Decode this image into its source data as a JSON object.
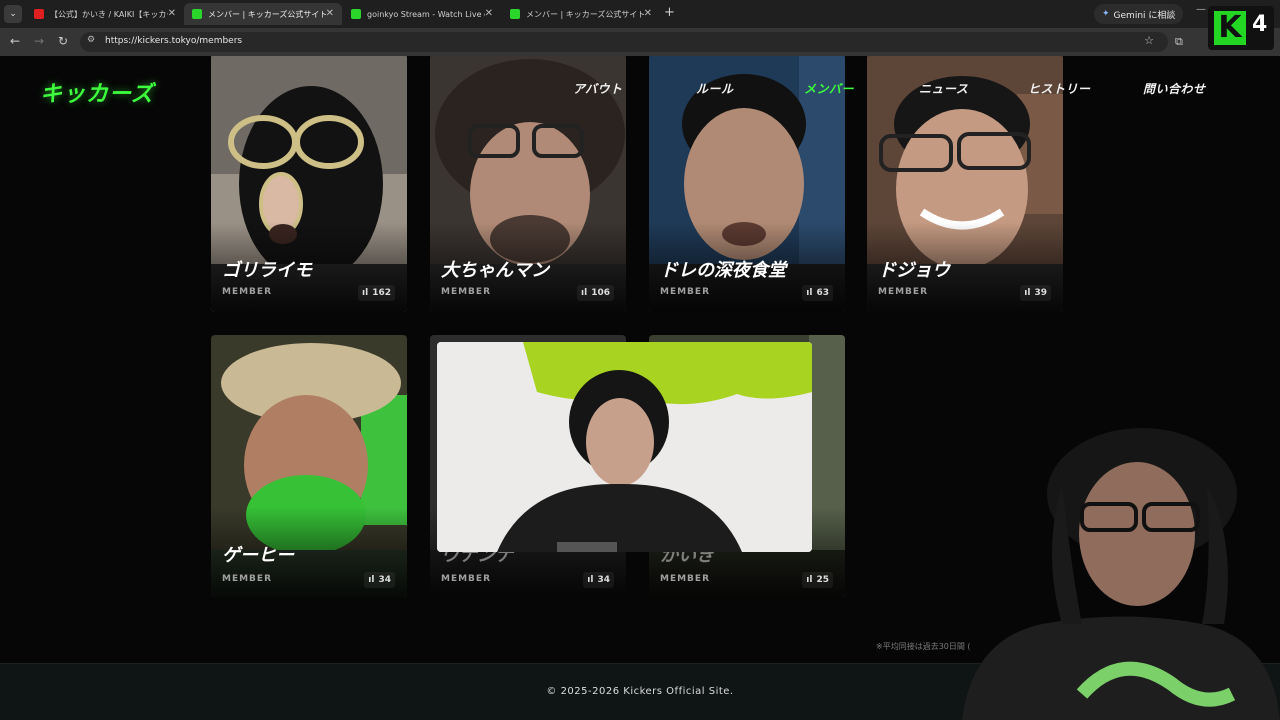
{
  "browser": {
    "tabs": [
      {
        "title": "【公式】かいき / KAIKI【キッカーズ",
        "active": false
      },
      {
        "title": "メンバー | キッカーズ公式サイト",
        "active": true
      },
      {
        "title": "goinkyo Stream - Watch Live o",
        "active": false
      },
      {
        "title": "メンバー | キッカーズ公式サイト",
        "active": false
      }
    ],
    "new_tab": "+",
    "gemini_label": "Gemini に相談",
    "url": "https://kickers.tokyo/members",
    "badge_letter": "K",
    "badge_number": "4"
  },
  "site": {
    "logo": "キッカーズ",
    "nav": [
      "アバウト",
      "ルール",
      "メンバー",
      "ニュース",
      "ヒストリー",
      "問い合わせ"
    ]
  },
  "members": [
    {
      "name": "ゴリライモ",
      "role": "MEMBER",
      "views": "162"
    },
    {
      "name": "大ちゃんマン",
      "role": "MEMBER",
      "views": "106"
    },
    {
      "name": "ドレの深夜食堂",
      "role": "MEMBER",
      "views": "63"
    },
    {
      "name": "ドジョウ",
      "role": "MEMBER",
      "views": "39"
    },
    {
      "name": "ゲーヒー",
      "role": "MEMBER",
      "views": "34"
    },
    {
      "name": "ウナンナ",
      "role": "MEMBER",
      "views": "34"
    },
    {
      "name": "かいき",
      "role": "MEMBER",
      "views": "25"
    }
  ],
  "note": "※平均同接は過去30日間 (",
  "footer": {
    "copyright": "© 2025-2026 Kickers Official Site."
  },
  "colors": {
    "accent": "#3dff3d",
    "background": "#060606"
  }
}
